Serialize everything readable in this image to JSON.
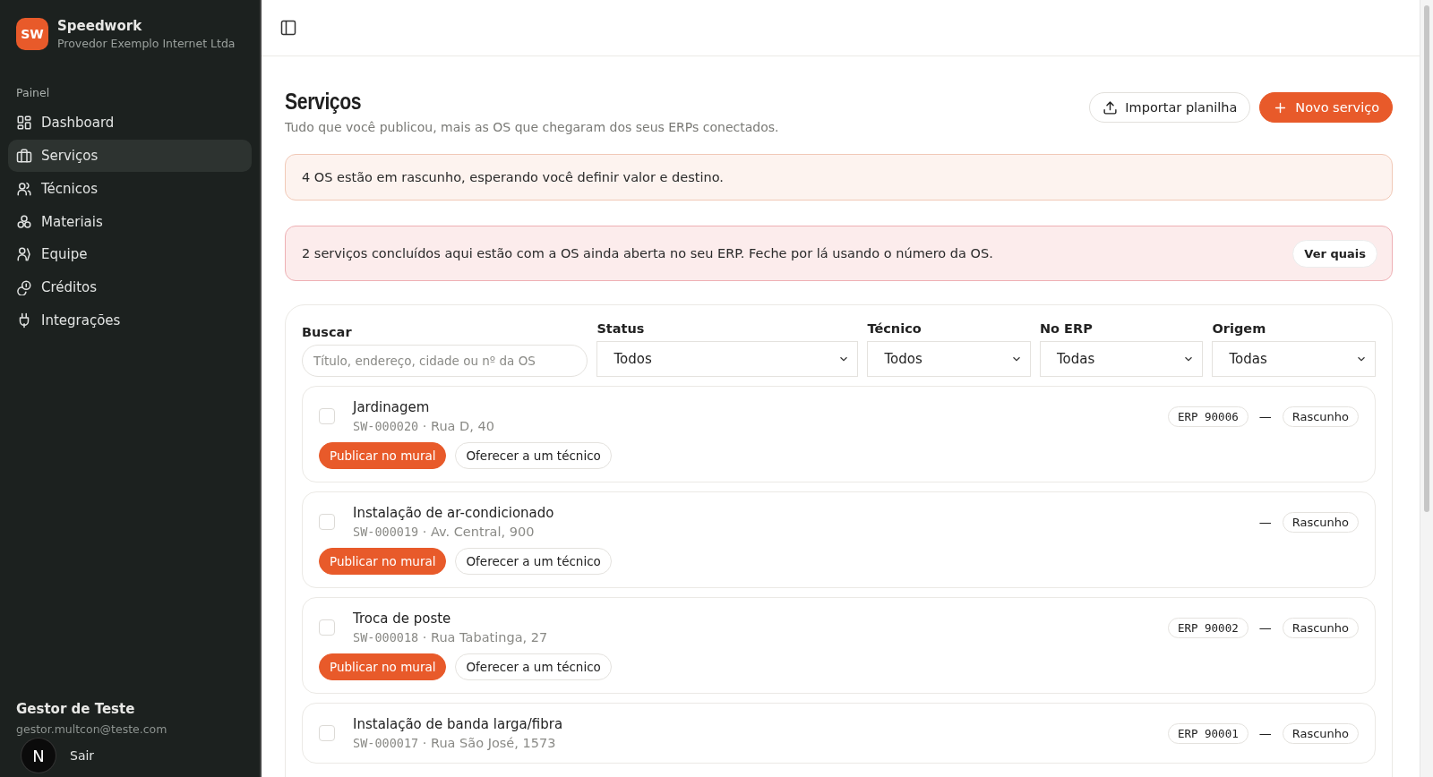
{
  "brand": {
    "initials": "SW",
    "name": "Speedwork",
    "org": "Provedor Exemplo Internet Ltda"
  },
  "sidebar": {
    "section": "Painel",
    "items": [
      {
        "label": "Dashboard",
        "selected": false
      },
      {
        "label": "Serviços",
        "selected": true
      },
      {
        "label": "Técnicos",
        "selected": false
      },
      {
        "label": "Materiais",
        "selected": false
      },
      {
        "label": "Equipe",
        "selected": false
      },
      {
        "label": "Créditos",
        "selected": false
      },
      {
        "label": "Integrações",
        "selected": false
      }
    ]
  },
  "user": {
    "name": "Gestor de Teste",
    "email": "gestor.multcon@teste.com",
    "logout": "Sair"
  },
  "dev_badge": {
    "label": "N"
  },
  "page": {
    "title": "Serviços",
    "subtitle": "Tudo que você publicou, mais as OS que chegaram dos seus ERPs conectados.",
    "import_button": "Importar planilha",
    "new_button": "Novo serviço"
  },
  "alerts": [
    {
      "kind": "warning",
      "text": "4 OS estão em rascunho, esperando você definir valor e destino."
    },
    {
      "kind": "danger",
      "text": "2 serviços concluídos aqui estão com a OS ainda aberta no seu ERP. Feche por lá usando o número da OS.",
      "action": "Ver quais"
    }
  ],
  "filters": {
    "search": {
      "label": "Buscar",
      "placeholder": "Título, endereço, cidade ou nº da OS"
    },
    "selects": [
      {
        "label": "Status",
        "value": "Todos"
      },
      {
        "label": "Técnico",
        "value": "Todos"
      },
      {
        "label": "No ERP",
        "value": "Todas"
      },
      {
        "label": "Origem",
        "value": "Todas"
      }
    ]
  },
  "services": [
    {
      "title": "Jardinagem",
      "code": "SW-000020",
      "separator": "·",
      "address": "Rua D, 40",
      "erp": "ERP 90006",
      "dash": "—",
      "status": "Rascunho",
      "checked": false,
      "actions": [
        "Publicar no mural",
        "Oferecer a um técnico"
      ]
    },
    {
      "title": "Instalação de ar-condicionado",
      "code": "SW-000019",
      "separator": "·",
      "address": "Av. Central, 900",
      "dash": "—",
      "status": "Rascunho",
      "checked": false,
      "actions": [
        "Publicar no mural",
        "Oferecer a um técnico"
      ]
    },
    {
      "title": "Troca de poste",
      "code": "SW-000018",
      "separator": "·",
      "address": "Rua Tabatinga, 27",
      "erp": "ERP 90002",
      "dash": "—",
      "status": "Rascunho",
      "checked": false,
      "actions": [
        "Publicar no mural",
        "Oferecer a um técnico"
      ]
    },
    {
      "title": "Instalação de banda larga/fibra",
      "code": "SW-000017",
      "separator": "·",
      "address": "Rua São José, 1573",
      "erp": "ERP 90001",
      "dash": "—",
      "status": "Rascunho",
      "checked": false
    }
  ]
}
